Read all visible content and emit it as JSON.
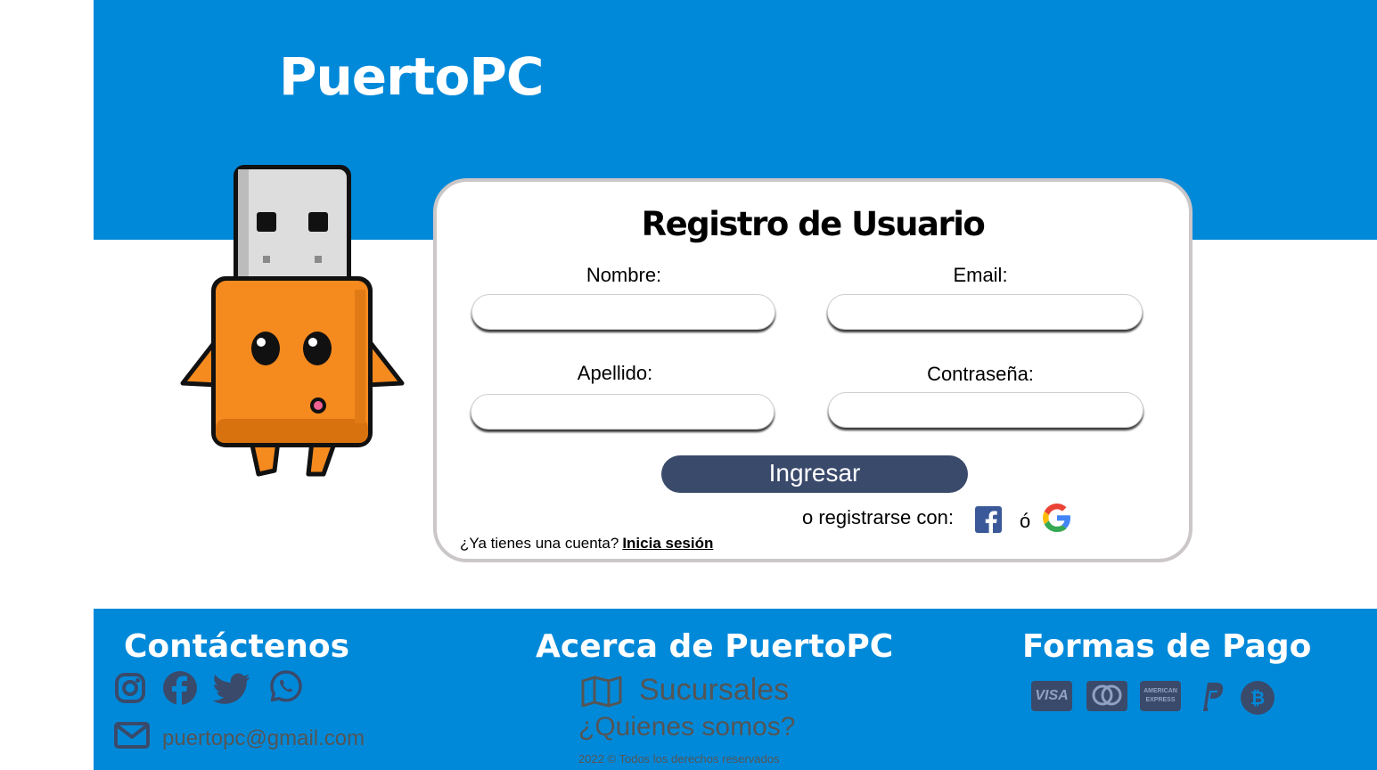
{
  "header": {
    "logo": "PuertoPC"
  },
  "form": {
    "title": "Registro de Usuario",
    "nombre_label": "Nombre:",
    "email_label": "Email:",
    "apellido_label": "Apellido:",
    "password_label": "Contraseña:",
    "nombre_value": "",
    "email_value": "",
    "apellido_value": "",
    "password_value": "",
    "submit_label": "Ingresar",
    "social_text": "o registrarse con:",
    "social_or": "ó",
    "account_question": "¿Ya tienes una cuenta?",
    "login_link": "Inicia sesión"
  },
  "footer": {
    "contact_title": "Contáctenos",
    "contact_email": "puertopc@gmail.com",
    "about_title": "Acerca de PuertoPC",
    "branches_link": "Sucursales",
    "about_link": "¿Quienes somos?",
    "copyright": "2022 © Todos los derechos reservados",
    "payment_title": "Formas de Pago",
    "payment_methods": [
      "VISA",
      "Mastercard",
      "American Express",
      "PayPal",
      "Bitcoin"
    ],
    "social_icons": [
      "instagram-icon",
      "facebook-icon",
      "twitter-icon",
      "whatsapp-icon"
    ]
  },
  "colors": {
    "brand_blue": "#0189d9",
    "button": "#3a4a6b",
    "usb_orange": "#f58a1f"
  }
}
